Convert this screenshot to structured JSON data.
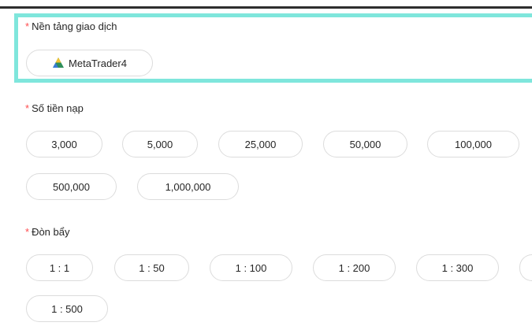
{
  "required_mark": "*",
  "platform": {
    "label": "Nền tảng giao dịch",
    "option": {
      "label": "MetaTrader4",
      "icon": "metatrader-logo-icon"
    }
  },
  "deposit": {
    "label": "Số tiền nạp",
    "options": [
      "3,000",
      "5,000",
      "25,000",
      "50,000",
      "100,000",
      "500,000",
      "1,000,000"
    ]
  },
  "leverage": {
    "label": "Đòn bẩy",
    "options": [
      "1 : 1",
      "1 : 50",
      "1 : 100",
      "1 : 200",
      "1 : 300",
      "1 : 500"
    ]
  },
  "colors": {
    "highlight": "#7fe6dc",
    "required": "#ff4d4f",
    "pill_border": "#dcdcdc"
  }
}
